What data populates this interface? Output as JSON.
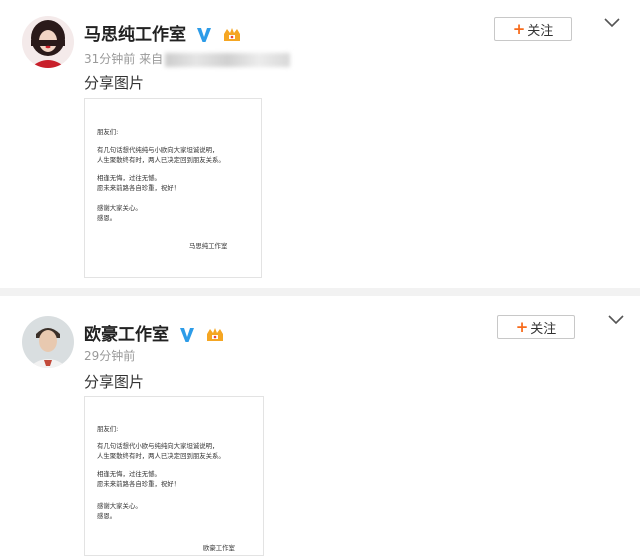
{
  "posts": [
    {
      "author": "马思纯工作室",
      "time": "31分钟前",
      "source_prefix": "来自",
      "share_text": "分享图片",
      "follow_label": "关注",
      "letter": {
        "greeting": "朋友们:",
        "line1": "有几句话想代纯纯与小欧向大家坦诚说明，",
        "line2": "人生聚散终有时，两人已决定回到朋友关系。",
        "line3": "相逢无悔，过往无憾。",
        "line4": "愿未来前路各自珍重，祝好！",
        "line5": "感谢大家关心。",
        "line6": "感恩。",
        "signature": "马思纯工作室"
      }
    },
    {
      "author": "欧豪工作室",
      "time": "29分钟前",
      "share_text": "分享图片",
      "follow_label": "关注",
      "letter": {
        "greeting": "朋友们:",
        "line1": "有几句话想代小欧与纯纯向大家坦诚说明，",
        "line2": "人生聚散终有时，两人已决定回到朋友关系。",
        "line3": "相逢无悔，过往无憾。",
        "line4": "愿未来前路各自珍重，祝好！",
        "line5": "感谢大家关心。",
        "line6": "感恩。",
        "signature": "欧豪工作室"
      }
    }
  ],
  "colors": {
    "verified": "#2d9ce8",
    "follow_plus": "#f76b1c",
    "vip_badge": "#f5a623"
  },
  "icons": [
    "verified-v-icon",
    "vip-badge-icon",
    "plus-icon",
    "chevron-down-icon"
  ]
}
